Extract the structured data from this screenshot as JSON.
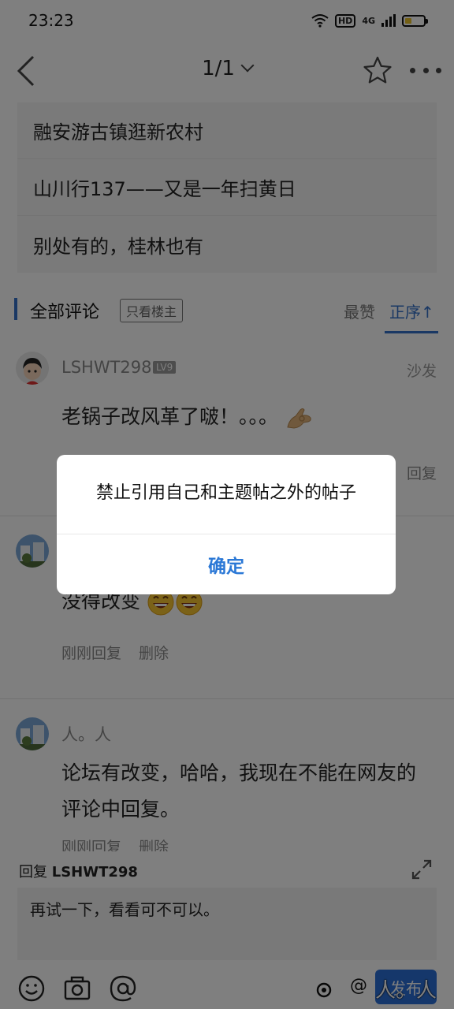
{
  "status_bar": {
    "time": "23:23",
    "hd": "HD",
    "network": "4G",
    "battery_level": 0.3,
    "battery_color": "#e8c02a"
  },
  "nav": {
    "page_indicator": "1/1"
  },
  "related_posts": [
    "融安游古镇逛新农村",
    "山川行137——又是一年扫黄日",
    "别处有的，桂林也有"
  ],
  "comments_header": {
    "title": "全部评论",
    "filter": "只看楼主",
    "sort_hot": "最赞",
    "sort_asc": "正序↑",
    "accent": "#3470c8"
  },
  "comments": [
    {
      "username": "LSHWT298",
      "level": "LV9",
      "floor": "沙发",
      "text": "老锅子改风革了啵！。。。",
      "reply": "回复"
    },
    {
      "text": "没得改变",
      "time": "刚刚回复",
      "delete": "删除"
    },
    {
      "username": "人。人",
      "text": "论坛有改变，哈哈，我现在不能在网友的评论中回复。",
      "time": "刚刚回复",
      "delete": "删除"
    }
  ],
  "reply_panel": {
    "prefix": "回复",
    "target": "LSHWT298",
    "input_value": "再试一下，看看可不可以。",
    "publish": "发布"
  },
  "watermark": {
    "at": "@",
    "text": "人。人"
  },
  "dialog": {
    "message": "禁止引用自己和主题帖之外的帖子",
    "confirm": "确定",
    "confirm_color": "#2b78d6"
  }
}
